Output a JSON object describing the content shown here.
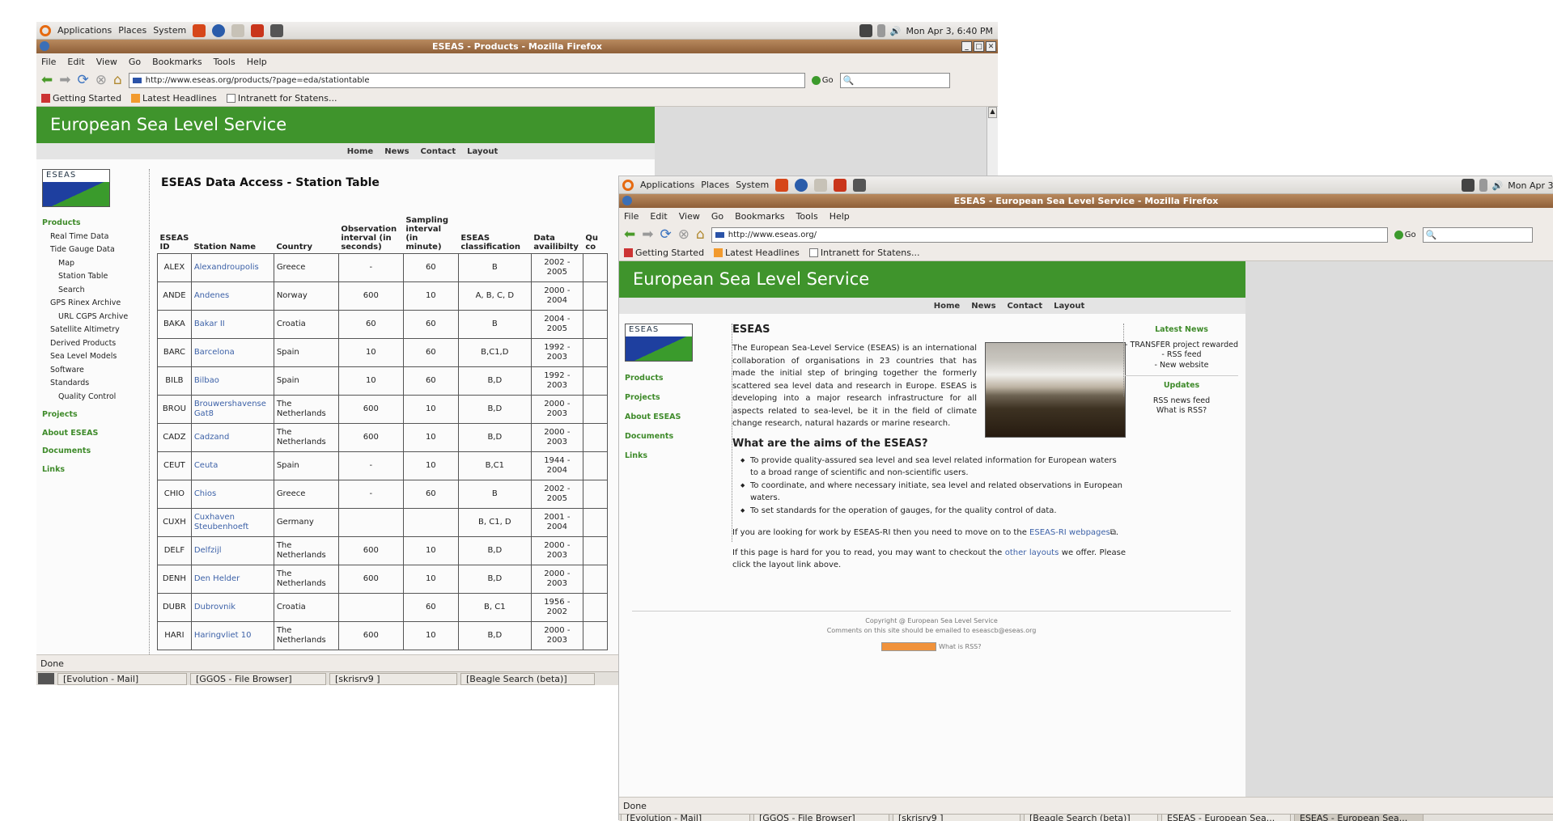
{
  "w1": {
    "panel": {
      "apps": "Applications",
      "places": "Places",
      "system": "System",
      "clock": "Mon Apr  3,  6:40 PM"
    },
    "title": "ESEAS - Products - Mozilla Firefox",
    "menu": [
      "File",
      "Edit",
      "View",
      "Go",
      "Bookmarks",
      "Tools",
      "Help"
    ],
    "url": "http://www.eseas.org/products/?page=eda/stationtable",
    "go": "Go",
    "bookmarks": [
      "Getting Started",
      "Latest Headlines",
      "Intranett for Statens..."
    ],
    "banner": "European Sea Level Service",
    "topnav": [
      "Home",
      "News",
      "Contact",
      "Layout"
    ],
    "logo_text": "ESEAS",
    "nav": [
      {
        "t": "Products",
        "c": "g"
      },
      {
        "t": "Real Time Data",
        "c": "l1"
      },
      {
        "t": "Tide Gauge Data",
        "c": "l1"
      },
      {
        "t": "Map",
        "c": "l2"
      },
      {
        "t": "Station Table",
        "c": "l2"
      },
      {
        "t": "Search",
        "c": "l2"
      },
      {
        "t": "GPS Rinex Archive",
        "c": "l1"
      },
      {
        "t": "URL CGPS Archive",
        "c": "l2"
      },
      {
        "t": "Satellite Altimetry",
        "c": "l1"
      },
      {
        "t": "Derived Products",
        "c": "l1"
      },
      {
        "t": "Sea Level Models",
        "c": "l1"
      },
      {
        "t": "Software",
        "c": "l1"
      },
      {
        "t": "Standards",
        "c": "l1"
      },
      {
        "t": "Quality Control",
        "c": "l2"
      },
      {
        "t": "Projects",
        "c": "g"
      },
      {
        "t": "About ESEAS",
        "c": "g"
      },
      {
        "t": "Documents",
        "c": "g"
      },
      {
        "t": "Links",
        "c": "g"
      }
    ],
    "heading": "ESEAS Data Access - Station Table",
    "columns": [
      "ESEAS ID",
      "Station Name",
      "Country",
      "Observation interval (in seconds)",
      "Sampling interval (in minute)",
      "ESEAS classification",
      "Data availibilty",
      "Qu co"
    ],
    "rows": [
      [
        "ALEX",
        "Alexandroupolis",
        "Greece",
        "-",
        "60",
        "B",
        "2002 - 2005"
      ],
      [
        "ANDE",
        "Andenes",
        "Norway",
        "600",
        "10",
        "A, B, C, D",
        "2000 - 2004"
      ],
      [
        "BAKA",
        "Bakar II",
        "Croatia",
        "60",
        "60",
        "B",
        "2004 - 2005"
      ],
      [
        "BARC",
        "Barcelona",
        "Spain",
        "10",
        "60",
        "B,C1,D",
        "1992 - 2003"
      ],
      [
        "BILB",
        "Bilbao",
        "Spain",
        "10",
        "60",
        "B,D",
        "1992 - 2003"
      ],
      [
        "BROU",
        "Brouwershavense Gat8",
        "The Netherlands",
        "600",
        "10",
        "B,D",
        "2000 - 2003"
      ],
      [
        "CADZ",
        "Cadzand",
        "The Netherlands",
        "600",
        "10",
        "B,D",
        "2000 - 2003"
      ],
      [
        "CEUT",
        "Ceuta",
        "Spain",
        "-",
        "10",
        "B,C1",
        "1944 - 2004"
      ],
      [
        "CHIO",
        "Chios",
        "Greece",
        "-",
        "60",
        "B",
        "2002 - 2005"
      ],
      [
        "CUXH",
        "Cuxhaven Steubenhoeft",
        "Germany",
        "",
        "",
        "B, C1, D",
        "2001 - 2004"
      ],
      [
        "DELF",
        "Delfzijl",
        "The Netherlands",
        "600",
        "10",
        "B,D",
        "2000 - 2003"
      ],
      [
        "DENH",
        "Den Helder",
        "The Netherlands",
        "600",
        "10",
        "B,D",
        "2000 - 2003"
      ],
      [
        "DUBR",
        "Dubrovnik",
        "Croatia",
        "",
        "60",
        "B, C1",
        "1956 - 2002"
      ],
      [
        "HARI",
        "Haringvliet 10",
        "The Netherlands",
        "600",
        "10",
        "B,D",
        "2000 - 2003"
      ]
    ],
    "status": "Done",
    "tasks": [
      "[Evolution - Mail]",
      "[GGOS - File Browser]",
      "[skrisrv9 ]",
      "[Beagle Search (beta)]"
    ]
  },
  "w2": {
    "panel": {
      "apps": "Applications",
      "places": "Places",
      "system": "System",
      "clock": "Mon Apr 3,"
    },
    "title": "ESEAS - European Sea Level Service - Mozilla Firefox",
    "menu": [
      "File",
      "Edit",
      "View",
      "Go",
      "Bookmarks",
      "Tools",
      "Help"
    ],
    "url": "http://www.eseas.org/",
    "go": "Go",
    "bookmarks": [
      "Getting Started",
      "Latest Headlines",
      "Intranett for Statens..."
    ],
    "banner": "European Sea Level Service",
    "topnav": [
      "Home",
      "News",
      "Contact",
      "Layout"
    ],
    "logo_text": "ESEAS",
    "nav": [
      "Products",
      "Projects",
      "About ESEAS",
      "Documents",
      "Links"
    ],
    "heading": "ESEAS",
    "intro": "The European Sea-Level Service (ESEAS) is an international collaboration of organisations in 23 countries that has made the initial step of bringing together the formerly scattered sea level data and research in Europe. ESEAS is developing into a major research infrastructure for all aspects related to sea-level, be it in the field of climate change research, natural hazards or marine research.",
    "aims_heading": "What are the aims of the ESEAS?",
    "aims": [
      "To provide quality-assured sea level and sea level related information for European waters to a broad range of scientific and non-scientific users.",
      "To coordinate, and where necessary initiate, sea level and related observations in European waters.",
      "To set standards for the operation of gauges, for the quality control of data."
    ],
    "work_text": "If you are looking for work by ESEAS-RI then you need to move on to the ",
    "work_link": "ESEAS-RI webpages",
    "read_text1": "If this page is hard for you to read, you may want to checkout the ",
    "read_link": "other layouts",
    "read_text2": " we offer. Please click the layout link above.",
    "latest_news": "Latest News",
    "news": [
      "- TRANSFER project rewarded",
      "- RSS feed",
      "- New website"
    ],
    "updates": "Updates",
    "update_links": [
      "RSS news feed",
      "What is RSS?"
    ],
    "copyright": "Copyright @ European Sea Level Service",
    "comments": "Comments on this site should be emailed to eseascb@eseas.org",
    "rss_q": "What is RSS?",
    "status": "Done",
    "tasks": [
      "[Evolution - Mail]",
      "[GGOS - File Browser]",
      "[skrisrv9 ]",
      "[Beagle Search (beta)]",
      "ESEAS - European Sea...",
      "ESEAS - European Sea..."
    ]
  }
}
